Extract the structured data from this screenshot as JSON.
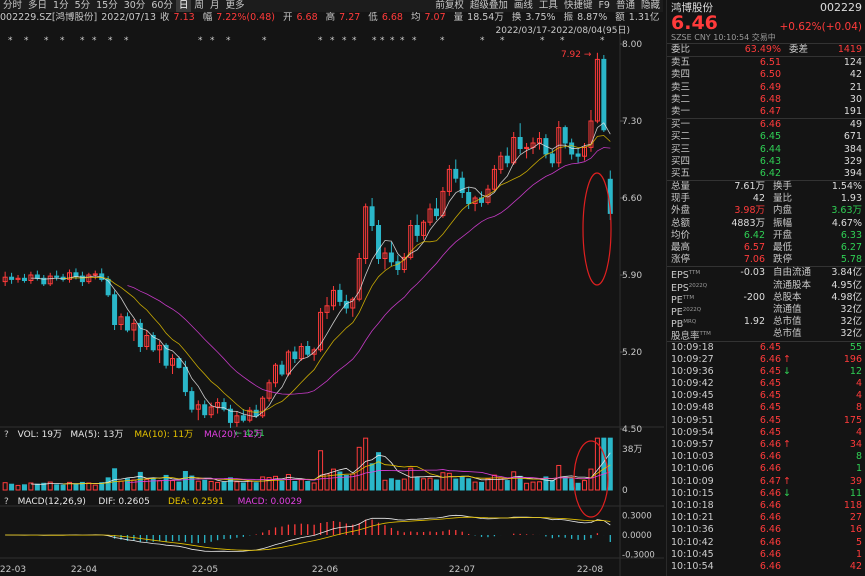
{
  "toolbar": {
    "periods": [
      "分时",
      "多日",
      "1分",
      "5分",
      "15分",
      "30分",
      "60分",
      "日",
      "周",
      "月",
      "更多"
    ],
    "active": "日",
    "right_items": [
      "前复权",
      "超级叠加",
      "画线",
      "工具",
      "快捷键",
      "F9",
      "普通",
      "隐藏"
    ]
  },
  "inforow": {
    "code": "002229.SZ[鸿博股份]",
    "date": "2022/07/13",
    "close_label": "收",
    "close": "7.13",
    "change_label": "幅",
    "change": "7.22%(0.48)",
    "open_label": "开",
    "open": "6.68",
    "high_label": "高",
    "high": "7.27",
    "low_label": "低",
    "low": "6.68",
    "avg_label": "均",
    "avg": "7.07",
    "vol_label": "量",
    "vol": "18.54万",
    "turnover_label": "换",
    "turnover": "3.75%",
    "amp_label": "振",
    "amp": "8.87%",
    "amount_label": "额",
    "amount": "1.31亿"
  },
  "chart_main": {
    "range_label": "2022/03/17-2022/08/04(95日)",
    "y_ticks": [
      "8.00",
      "7.30",
      "6.60",
      "5.90",
      "5.20",
      "4.50"
    ],
    "max_label": "7.92",
    "min_label": "4.51",
    "x_ticks": [
      "22-03",
      "22-04",
      "22-05",
      "22-06",
      "22-07",
      "22-08"
    ],
    "colors": {
      "up": "#ff3b3b",
      "down": "#2ab7c9",
      "ma5": "#e8e8e8",
      "ma10": "#e5c200",
      "ma20": "#e040e0"
    }
  },
  "vol_panel": {
    "legend": {
      "q": "?",
      "vol": "VOL: 19万",
      "ma5": "MA(5): 13万",
      "ma10": "MA(10): 11万",
      "ma20": "MA(20): 12万"
    },
    "y_ticks": [
      "38万",
      "0"
    ]
  },
  "macd_panel": {
    "legend": {
      "q": "?",
      "name": "MACD(12,26,9)",
      "dif": "DIF: 0.2605",
      "dea": "DEA: 0.2591",
      "macd": "MACD: 0.0029"
    },
    "y_ticks": [
      "0.3000",
      "0.0000",
      "-0.3000"
    ]
  },
  "chart_data": {
    "type": "candlestick",
    "x_range": [
      "2022-03-17",
      "2022-08-04"
    ],
    "days": 95,
    "ylim": [
      4.5,
      8.0
    ],
    "price_labels": {
      "max": 7.92,
      "min": 4.51
    },
    "ohlc": [
      [
        5.84,
        5.93,
        5.8,
        5.88
      ],
      [
        5.88,
        5.92,
        5.82,
        5.86
      ],
      [
        5.86,
        5.9,
        5.83,
        5.87
      ],
      [
        5.87,
        5.91,
        5.83,
        5.85
      ],
      [
        5.85,
        5.93,
        5.82,
        5.9
      ],
      [
        5.9,
        5.94,
        5.85,
        5.87
      ],
      [
        5.87,
        5.9,
        5.8,
        5.82
      ],
      [
        5.82,
        5.92,
        5.8,
        5.89
      ],
      [
        5.89,
        5.94,
        5.85,
        5.88
      ],
      [
        5.88,
        5.91,
        5.84,
        5.86
      ],
      [
        5.86,
        5.95,
        5.83,
        5.92
      ],
      [
        5.92,
        5.96,
        5.86,
        5.89
      ],
      [
        5.89,
        5.93,
        5.8,
        5.84
      ],
      [
        5.84,
        5.92,
        5.82,
        5.9
      ],
      [
        5.9,
        5.94,
        5.86,
        5.91
      ],
      [
        5.91,
        5.96,
        5.84,
        5.86
      ],
      [
        5.86,
        5.89,
        5.7,
        5.72
      ],
      [
        5.72,
        5.76,
        5.4,
        5.45
      ],
      [
        5.45,
        5.55,
        5.4,
        5.52
      ],
      [
        5.52,
        5.56,
        5.38,
        5.4
      ],
      [
        5.4,
        5.5,
        5.3,
        5.46
      ],
      [
        5.46,
        5.5,
        5.2,
        5.25
      ],
      [
        5.25,
        5.4,
        5.22,
        5.35
      ],
      [
        5.35,
        5.38,
        5.2,
        5.22
      ],
      [
        5.22,
        5.3,
        5.1,
        5.26
      ],
      [
        5.26,
        5.28,
        5.05,
        5.08
      ],
      [
        5.08,
        5.18,
        5.0,
        5.14
      ],
      [
        5.14,
        5.16,
        5.05,
        5.06
      ],
      [
        5.06,
        5.12,
        4.8,
        4.84
      ],
      [
        4.84,
        4.88,
        4.65,
        4.68
      ],
      [
        4.68,
        4.76,
        4.58,
        4.72
      ],
      [
        4.72,
        4.76,
        4.6,
        4.63
      ],
      [
        4.63,
        4.74,
        4.6,
        4.7
      ],
      [
        4.7,
        4.78,
        4.64,
        4.74
      ],
      [
        4.74,
        4.78,
        4.66,
        4.68
      ],
      [
        4.68,
        4.72,
        4.51,
        4.56
      ],
      [
        4.56,
        4.66,
        4.52,
        4.62
      ],
      [
        4.62,
        4.68,
        4.56,
        4.58
      ],
      [
        4.58,
        4.7,
        4.56,
        4.67
      ],
      [
        4.67,
        4.72,
        4.6,
        4.62
      ],
      [
        4.62,
        4.8,
        4.6,
        4.78
      ],
      [
        4.78,
        4.95,
        4.75,
        4.92
      ],
      [
        4.92,
        5.1,
        4.88,
        5.08
      ],
      [
        5.08,
        5.12,
        4.98,
        5.0
      ],
      [
        5.0,
        5.22,
        4.98,
        5.2
      ],
      [
        5.2,
        5.25,
        5.1,
        5.14
      ],
      [
        5.14,
        5.28,
        5.12,
        5.25
      ],
      [
        5.25,
        5.3,
        5.16,
        5.18
      ],
      [
        5.18,
        5.24,
        5.12,
        5.22
      ],
      [
        5.22,
        5.6,
        5.2,
        5.56
      ],
      [
        5.56,
        5.7,
        5.5,
        5.62
      ],
      [
        5.62,
        5.8,
        5.58,
        5.76
      ],
      [
        5.76,
        5.82,
        5.62,
        5.66
      ],
      [
        5.66,
        5.72,
        5.55,
        5.6
      ],
      [
        5.6,
        5.7,
        5.52,
        5.68
      ],
      [
        5.68,
        6.1,
        5.66,
        6.05
      ],
      [
        6.05,
        6.55,
        6.0,
        6.52
      ],
      [
        6.52,
        6.6,
        6.3,
        6.35
      ],
      [
        6.35,
        6.4,
        6.0,
        6.05
      ],
      [
        6.05,
        6.15,
        5.95,
        6.1
      ],
      [
        6.1,
        6.2,
        5.98,
        6.02
      ],
      [
        6.02,
        6.08,
        5.9,
        5.95
      ],
      [
        5.95,
        6.1,
        5.92,
        6.06
      ],
      [
        6.06,
        6.4,
        6.04,
        6.35
      ],
      [
        6.35,
        6.45,
        6.2,
        6.26
      ],
      [
        6.26,
        6.4,
        6.22,
        6.38
      ],
      [
        6.38,
        6.55,
        6.35,
        6.5
      ],
      [
        6.5,
        6.6,
        6.4,
        6.44
      ],
      [
        6.44,
        6.7,
        6.42,
        6.66
      ],
      [
        6.66,
        6.9,
        6.62,
        6.86
      ],
      [
        6.86,
        6.95,
        6.74,
        6.78
      ],
      [
        6.78,
        6.84,
        6.6,
        6.65
      ],
      [
        6.65,
        6.7,
        6.5,
        6.55
      ],
      [
        6.55,
        6.62,
        6.48,
        6.6
      ],
      [
        6.6,
        6.66,
        6.52,
        6.56
      ],
      [
        6.56,
        6.72,
        6.54,
        6.68
      ],
      [
        6.68,
        6.9,
        6.66,
        6.86
      ],
      [
        6.86,
        7.02,
        6.82,
        6.98
      ],
      [
        6.98,
        7.06,
        6.88,
        6.92
      ],
      [
        6.92,
        7.2,
        6.9,
        7.15
      ],
      [
        7.15,
        7.28,
        7.0,
        7.05
      ],
      [
        7.05,
        7.1,
        6.96,
        7.06
      ],
      [
        7.06,
        7.15,
        7.0,
        7.1
      ],
      [
        7.1,
        7.2,
        7.04,
        7.14
      ],
      [
        7.14,
        7.18,
        6.96,
        7.0
      ],
      [
        7.0,
        7.04,
        6.88,
        6.92
      ],
      [
        6.92,
        7.3,
        6.88,
        7.24
      ],
      [
        7.24,
        7.26,
        7.05,
        7.1
      ],
      [
        7.1,
        7.14,
        6.95,
        7.0
      ],
      [
        7.0,
        7.05,
        6.92,
        6.98
      ],
      [
        6.98,
        7.1,
        6.94,
        7.06
      ],
      [
        7.06,
        7.4,
        7.02,
        7.3
      ],
      [
        7.3,
        7.92,
        7.28,
        7.86
      ],
      [
        7.86,
        7.9,
        7.2,
        7.22
      ],
      [
        6.77,
        6.85,
        6.4,
        6.46
      ]
    ],
    "volume_ylim": [
      0,
      500000
    ],
    "volume_ticks": [
      380000,
      0
    ],
    "macd_ylim": [
      -0.35,
      0.35
    ],
    "macd_ticks": [
      0.3,
      0,
      -0.3
    ],
    "last_vol": 190000,
    "ma": {
      "vol_ma5": 130000,
      "vol_ma10": 110000,
      "vol_ma20": 120000
    }
  },
  "panel": {
    "name": "鸿博股份",
    "code": "002229",
    "price": "6.46",
    "change": "+0.62%",
    "change_amt": "(+0.04)",
    "sub": [
      "SZSE",
      "CNY",
      "10:10:54",
      "交易中"
    ],
    "weibi_label": "委比",
    "weibi": "63.49%",
    "weicha_label": "委差",
    "weicha": "1419",
    "asks": [
      {
        "label": "卖五",
        "price": "6.51",
        "vol": "124"
      },
      {
        "label": "卖四",
        "price": "6.50",
        "vol": "42"
      },
      {
        "label": "卖三",
        "price": "6.49",
        "vol": "21"
      },
      {
        "label": "卖二",
        "price": "6.48",
        "vol": "30"
      },
      {
        "label": "卖一",
        "price": "6.47",
        "vol": "191"
      }
    ],
    "bids": [
      {
        "label": "买一",
        "price": "6.46",
        "vol": "49"
      },
      {
        "label": "买二",
        "price": "6.45",
        "vol": "671"
      },
      {
        "label": "买三",
        "price": "6.44",
        "vol": "384"
      },
      {
        "label": "买四",
        "price": "6.43",
        "vol": "329"
      },
      {
        "label": "买五",
        "price": "6.42",
        "vol": "394"
      }
    ],
    "stats": [
      {
        "a": "总量",
        "b": "7.61万",
        "bc": "w",
        "c": "换手",
        "d": "1.54%",
        "dc": "w"
      },
      {
        "a": "现手",
        "b": "42",
        "bc": "w",
        "c": "量比",
        "d": "1.93",
        "dc": "w"
      },
      {
        "a": "外盘",
        "b": "3.98万",
        "bc": "r",
        "c": "内盘",
        "d": "3.63万",
        "dc": "g"
      },
      {
        "a": "总额",
        "b": "4883万",
        "bc": "w",
        "c": "振幅",
        "d": "4.67%",
        "dc": "w"
      },
      {
        "a": "均价",
        "b": "6.42",
        "bc": "g",
        "c": "开盘",
        "d": "6.33",
        "dc": "g"
      },
      {
        "a": "最高",
        "b": "6.57",
        "bc": "r",
        "c": "最低",
        "d": "6.27",
        "dc": "g"
      },
      {
        "a": "涨停",
        "b": "7.06",
        "bc": "r",
        "c": "跌停",
        "d": "5.78",
        "dc": "g"
      }
    ],
    "fin": [
      {
        "a": "EPS",
        "sup": "TTM",
        "b": "-0.03",
        "c": "自由流通",
        "d": "3.84亿"
      },
      {
        "a": "EPS",
        "sup": "2022Q",
        "b": "",
        "c": "流通股本",
        "d": "4.95亿"
      },
      {
        "a": "PE",
        "sup": "TTM",
        "b": "-200",
        "c": "总股本",
        "d": "4.98亿"
      },
      {
        "a": "PE",
        "sup": "2022Q",
        "b": "",
        "c": "流通值",
        "d": "32亿"
      },
      {
        "a": "PB",
        "sup": "MRQ",
        "b": "1.92",
        "c": "总市值",
        "d": "32亿"
      },
      {
        "a": "股息率",
        "sup": "TTM",
        "b": "",
        "c": "总市值",
        "d": "32亿"
      }
    ],
    "ticks": [
      {
        "t": "10:09:18",
        "p": "6.45",
        "a": "",
        "v": "55",
        "c": "g"
      },
      {
        "t": "10:09:27",
        "p": "6.46",
        "a": "↑",
        "v": "196",
        "c": "r"
      },
      {
        "t": "10:09:36",
        "p": "6.45",
        "a": "↓",
        "v": "12",
        "c": "g"
      },
      {
        "t": "10:09:42",
        "p": "6.45",
        "a": "",
        "v": "4",
        "c": "r"
      },
      {
        "t": "10:09:45",
        "p": "6.45",
        "a": "",
        "v": "4",
        "c": "r"
      },
      {
        "t": "10:09:48",
        "p": "6.45",
        "a": "",
        "v": "8",
        "c": "r"
      },
      {
        "t": "10:09:51",
        "p": "6.45",
        "a": "",
        "v": "175",
        "c": "r"
      },
      {
        "t": "10:09:54",
        "p": "6.45",
        "a": "",
        "v": "4",
        "c": "r"
      },
      {
        "t": "10:09:57",
        "p": "6.46",
        "a": "↑",
        "v": "34",
        "c": "r"
      },
      {
        "t": "10:10:03",
        "p": "6.46",
        "a": "",
        "v": "8",
        "c": "g"
      },
      {
        "t": "10:10:06",
        "p": "6.46",
        "a": "",
        "v": "1",
        "c": "g"
      },
      {
        "t": "10:10:09",
        "p": "6.47",
        "a": "↑",
        "v": "39",
        "c": "r"
      },
      {
        "t": "10:10:15",
        "p": "6.46",
        "a": "↓",
        "v": "11",
        "c": "g"
      },
      {
        "t": "10:10:18",
        "p": "6.46",
        "a": "",
        "v": "118",
        "c": "r"
      },
      {
        "t": "10:10:21",
        "p": "6.46",
        "a": "",
        "v": "27",
        "c": "r"
      },
      {
        "t": "10:10:36",
        "p": "6.46",
        "a": "",
        "v": "16",
        "c": "r"
      },
      {
        "t": "10:10:42",
        "p": "6.46",
        "a": "",
        "v": "5",
        "c": "r"
      },
      {
        "t": "10:10:45",
        "p": "6.46",
        "a": "",
        "v": "1",
        "c": "r"
      },
      {
        "t": "10:10:54",
        "p": "6.46",
        "a": "",
        "v": "42",
        "c": "r"
      }
    ]
  }
}
